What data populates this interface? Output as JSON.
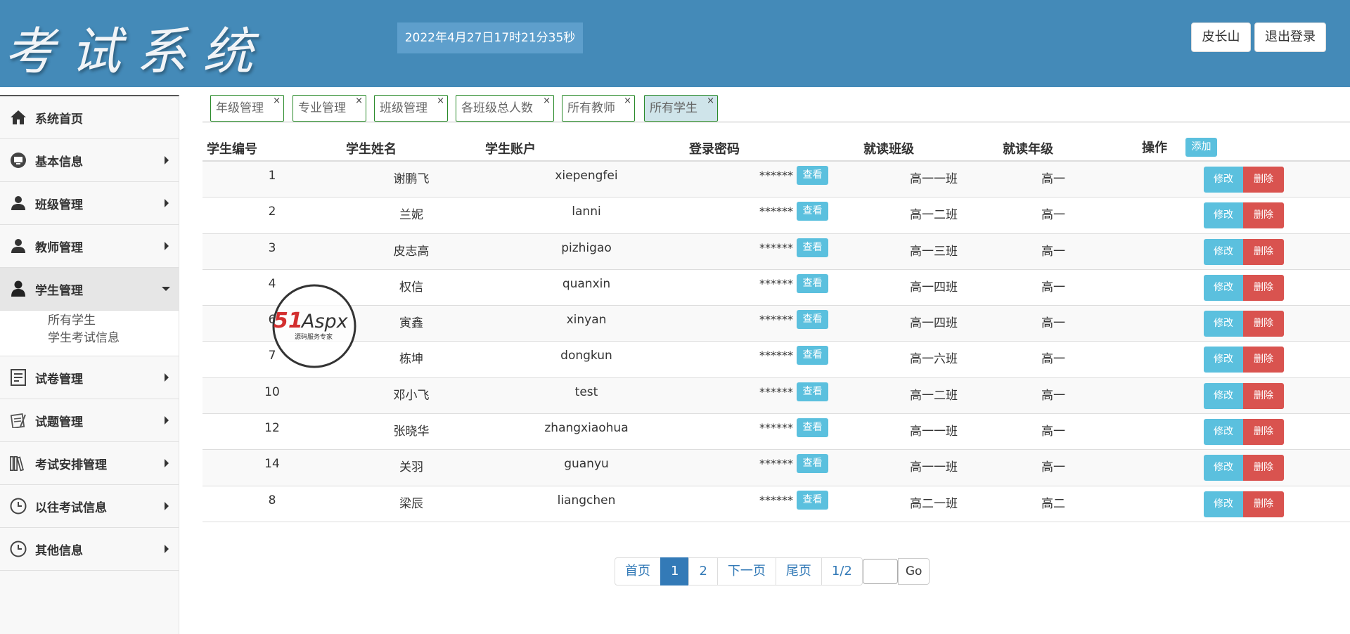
{
  "header": {
    "logo": "考试系统",
    "datetime": "2022年4月27日17时21分35秒",
    "user_name": "皮长山",
    "logout_label": "退出登录"
  },
  "sidebar": {
    "items": [
      {
        "label": "系统首页",
        "icon": "home-icon"
      },
      {
        "label": "基本信息",
        "icon": "monitor-icon"
      },
      {
        "label": "班级管理",
        "icon": "users-icon"
      },
      {
        "label": "教师管理",
        "icon": "teacher-icon"
      },
      {
        "label": "学生管理",
        "icon": "student-icon"
      },
      {
        "label": "试卷管理",
        "icon": "paper-icon"
      },
      {
        "label": "试题管理",
        "icon": "question-icon"
      },
      {
        "label": "考试安排管理",
        "icon": "books-icon"
      },
      {
        "label": "以往考试信息",
        "icon": "clock-icon"
      },
      {
        "label": "其他信息",
        "icon": "clock-icon"
      }
    ],
    "submenu": [
      "所有学生",
      "学生考试信息"
    ]
  },
  "tabs": [
    {
      "label": "年级管理"
    },
    {
      "label": "专业管理"
    },
    {
      "label": "班级管理"
    },
    {
      "label": "各班级总人数"
    },
    {
      "label": "所有教师"
    },
    {
      "label": "所有学生"
    }
  ],
  "tab_close": "×",
  "table": {
    "headers": [
      "学生编号",
      "学生姓名",
      "学生账户",
      "登录密码",
      "就读班级",
      "就读年级",
      "操作"
    ],
    "add_label": "添加",
    "view_label": "查看",
    "edit_label": "修改",
    "delete_label": "删除",
    "rows": [
      {
        "id": "1",
        "name": "谢鹏飞",
        "account": "xiepengfei",
        "pwd": "******",
        "class": "高一一班",
        "grade": "高一"
      },
      {
        "id": "2",
        "name": "兰妮",
        "account": "lanni",
        "pwd": "******",
        "class": "高一二班",
        "grade": "高一"
      },
      {
        "id": "3",
        "name": "皮志高",
        "account": "pizhigao",
        "pwd": "******",
        "class": "高一三班",
        "grade": "高一"
      },
      {
        "id": "4",
        "name": "权信",
        "account": "quanxin",
        "pwd": "******",
        "class": "高一四班",
        "grade": "高一"
      },
      {
        "id": "6",
        "name": "寅鑫",
        "account": "xinyan",
        "pwd": "******",
        "class": "高一四班",
        "grade": "高一"
      },
      {
        "id": "7",
        "name": "栋坤",
        "account": "dongkun",
        "pwd": "******",
        "class": "高一六班",
        "grade": "高一"
      },
      {
        "id": "10",
        "name": "邓小飞",
        "account": "test",
        "pwd": "******",
        "class": "高一二班",
        "grade": "高一"
      },
      {
        "id": "12",
        "name": "张晓华",
        "account": "zhangxiaohua",
        "pwd": "******",
        "class": "高一一班",
        "grade": "高一"
      },
      {
        "id": "14",
        "name": "关羽",
        "account": "guanyu",
        "pwd": "******",
        "class": "高一一班",
        "grade": "高一"
      },
      {
        "id": "8",
        "name": "梁辰",
        "account": "liangchen",
        "pwd": "******",
        "class": "高二一班",
        "grade": "高二"
      }
    ]
  },
  "pager": {
    "first": "首页",
    "pages": [
      "1",
      "2"
    ],
    "next": "下一页",
    "last": "尾页",
    "info": "1/2",
    "go": "Go",
    "input_value": ""
  },
  "watermark": {
    "brand": "51Aspx",
    "tagline": "源码服务专家"
  },
  "colors": {
    "header": "#448ab8",
    "info_btn": "#5bc0de",
    "danger_btn": "#d9534f",
    "primary": "#337ab7"
  }
}
